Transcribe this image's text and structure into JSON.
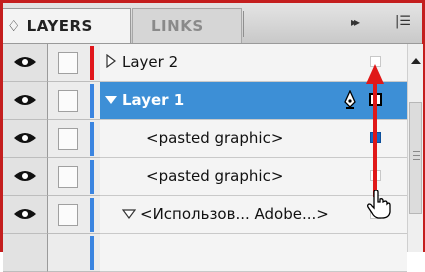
{
  "tabs": {
    "layers_label": "♢ LAYERS",
    "links_label": "LINKS",
    "fastforward_glyph": "▸▸",
    "menu_glyph": "|☰"
  },
  "layers": [
    {
      "name": "Layer 2",
      "expanded": false,
      "selected": false,
      "color": "#e0151a",
      "target": "empty"
    },
    {
      "name": "Layer 1",
      "expanded": true,
      "selected": true,
      "color": "#3a84e0",
      "target": "selected"
    },
    {
      "name": "<pasted graphic>",
      "expanded": null,
      "selected": false,
      "color": "#3a84e0",
      "target": "filled"
    },
    {
      "name": "<pasted graphic>",
      "expanded": null,
      "selected": false,
      "color": "#3a84e0",
      "target": "empty"
    },
    {
      "name": "<Использов... Adobe...>",
      "expanded": true,
      "selected": false,
      "color": "#3a84e0",
      "target": "empty"
    }
  ],
  "colors": {
    "selection": "#3d8fd6",
    "annotation_arrow": "#e01818",
    "frame": "#c41e1e"
  }
}
